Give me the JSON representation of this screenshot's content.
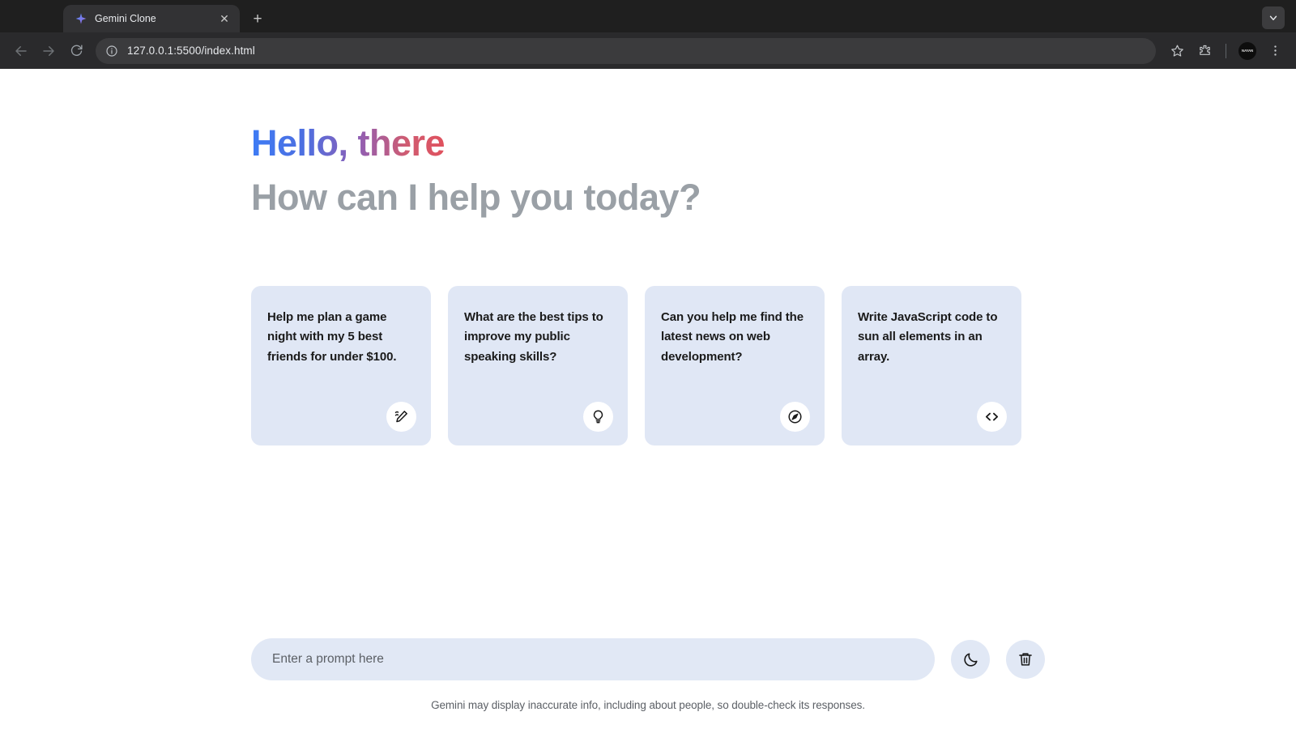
{
  "browser": {
    "tab": {
      "title": "Gemini Clone",
      "favicon": "sparkle-icon",
      "close": "✕"
    },
    "new_tab_label": "+",
    "tab_search": "chevron-down-icon",
    "nav": {
      "back": "back-arrow-icon",
      "forward": "forward-arrow-icon",
      "reload": "reload-icon"
    },
    "omnibox": {
      "site_info": "info-icon",
      "url": "127.0.0.1:5500/index.html"
    },
    "actions": {
      "bookmark": "star-icon",
      "extensions": "puzzle-icon",
      "profile": "avatar",
      "profile_text": "NAYAN",
      "menu": "three-dot-menu-icon"
    }
  },
  "app": {
    "greeting": {
      "line1": "Hello, there",
      "line2": "How can I help you today?",
      "gradient_start": "#3d7bf5",
      "gradient_end": "#e0515d",
      "subtitle_color": "#9aa0a6"
    },
    "cards": [
      {
        "text": "Help me plan a game night with my 5 best friends for under $100.",
        "icon": "draw-pen-icon"
      },
      {
        "text": "What are the best tips to improve my public speaking skills?",
        "icon": "lightbulb-icon"
      },
      {
        "text": "Can you help me find the latest news on web development?",
        "icon": "compass-explore-icon"
      },
      {
        "text": "Write JavaScript code to sun all elements in an array.",
        "icon": "code-icon"
      }
    ],
    "card_bg": "#e0e7f5",
    "prompt": {
      "placeholder": "Enter a prompt here",
      "value": ""
    },
    "buttons": {
      "theme_toggle": "moon-icon",
      "delete_chat": "trash-icon"
    },
    "disclaimer": "Gemini may display inaccurate info, including about people, so double-check its responses."
  }
}
